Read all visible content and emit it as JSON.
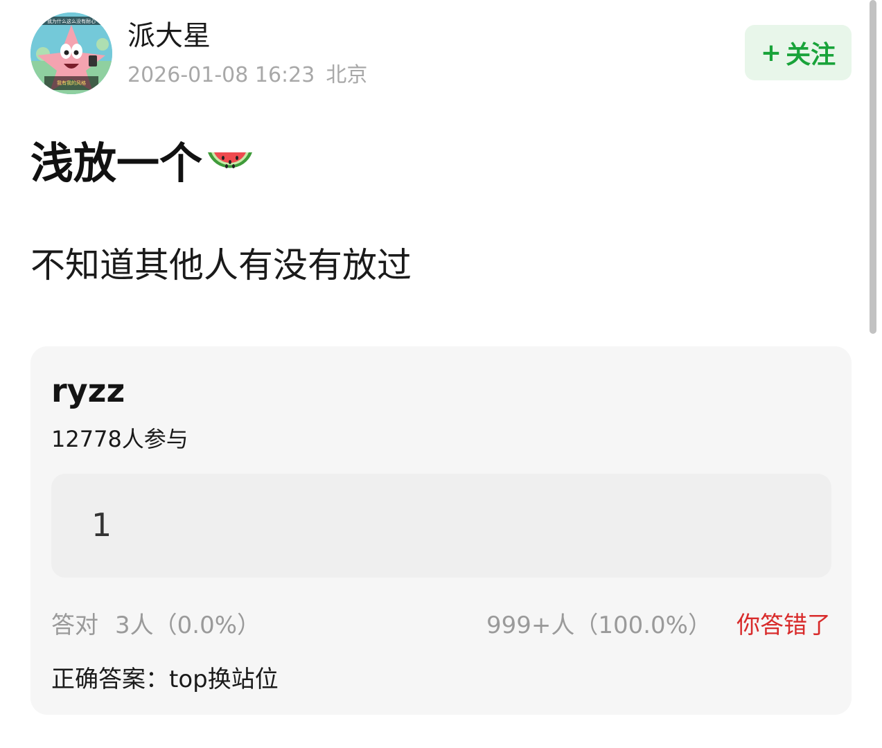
{
  "post": {
    "author": {
      "name": "派大星",
      "avatar_icon": "patrick-star-avatar",
      "avatar_caption_top": "我为什么这么没有耐心",
      "avatar_caption_bottom": "我有我的风格"
    },
    "timestamp": "2026-01-08 16:23",
    "location": "北京",
    "follow_button": {
      "plus": "+",
      "label": "关注"
    },
    "title": "浅放一个",
    "title_emoji_icon": "watermelon-icon",
    "body": "不知道其他人有没有放过"
  },
  "quiz": {
    "title": "ryzz",
    "participants": "12778人参与",
    "user_answer": "1",
    "correct_stats": {
      "label": "答对",
      "value": "3人（0.0%）"
    },
    "wrong_stats": {
      "value": "999+人（100.0%）",
      "status": "你答错了"
    },
    "correct_answer": "正确答案：top换站位"
  },
  "colors": {
    "follow_bg": "#e8f6ea",
    "follow_text": "#19a33a",
    "wrong_text": "#d82b2b",
    "card_bg": "#f6f6f6",
    "muted_text": "#9a9a9a"
  }
}
